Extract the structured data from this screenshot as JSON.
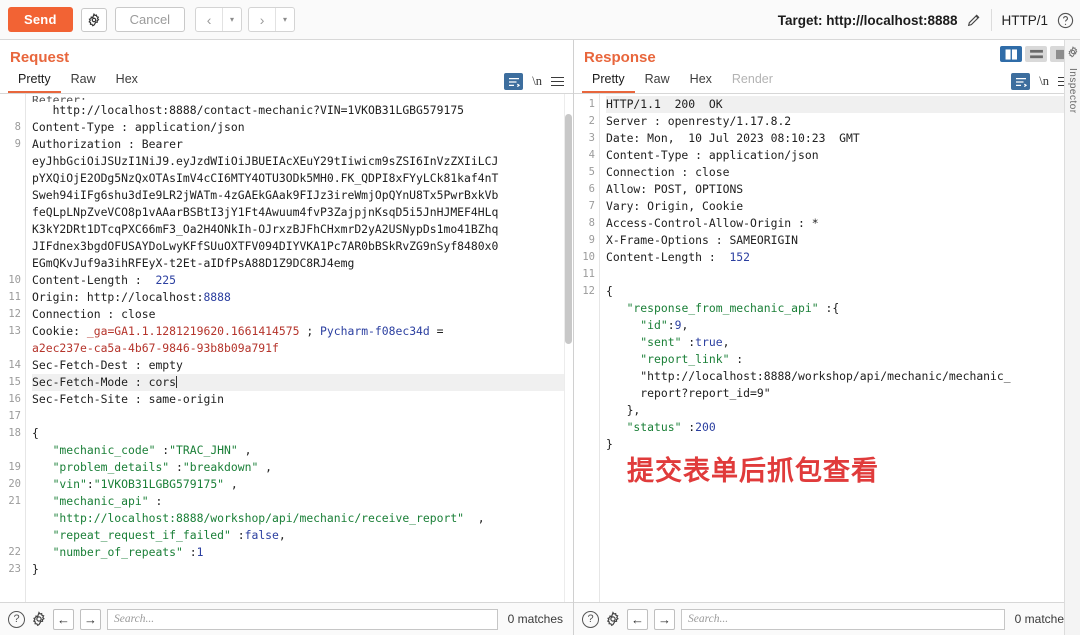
{
  "toolbar": {
    "send_label": "Send",
    "settings_icon": "gear-icon",
    "cancel_label": "Cancel",
    "prev_arrow": "‹",
    "next_arrow": "›",
    "caret": "▾",
    "target_label": "Target: http://localhost:8888",
    "edit_icon": "pencil-icon",
    "http_version": "HTTP/1",
    "help_icon": "question-circle-icon"
  },
  "request": {
    "title": "Request",
    "tabs": [
      {
        "label": "Pretty",
        "active": true,
        "disabled": false
      },
      {
        "label": "Raw",
        "active": false,
        "disabled": false
      },
      {
        "label": "Hex",
        "active": false,
        "disabled": false
      }
    ],
    "format_icon": "format-lines-icon",
    "newline_label": "\\n",
    "menu_icon": "hamburger-icon",
    "lines": [
      {
        "num": "",
        "text": "Referer:",
        "cut": true
      },
      {
        "num": "",
        "text": "   http://localhost:8888/contact-mechanic?VIN=1VKOB31LGBG579175"
      },
      {
        "num": "8",
        "text": "Content-Type : application/json"
      },
      {
        "num": "9",
        "text": "Authorization : Bearer"
      },
      {
        "num": "",
        "text": "eyJhbGciOiJSUzI1NiJ9.eyJzdWIiOiJBUEIAcXEuY29tIiwicm9sZSI6InVzZXIiLCJ"
      },
      {
        "num": "",
        "text": "pYXQiOjE2ODg5NzQxOTAsImV4cCI6MTY4OTU3ODk5MH0.FK_QDPI8xFYyLCk81kaf4nT"
      },
      {
        "num": "",
        "text": "Sweh94iIFg6shu3dIe9LR2jWATm-4zGAEkGAak9FIJz3ireWmjOpQYnU8Tx5PwrBxkVb"
      },
      {
        "num": "",
        "text": "feQLpLNpZveVCO8p1vAAarBSBtI3jY1Ft4Awuum4fvP3ZajpjnKsqD5i5JnHJMEF4HLq"
      },
      {
        "num": "",
        "text": "K3kY2DRt1DTcqPXC66mF3_Oa2H4ONkIh-OJrxzBJFhCHxmrD2yA2USNypDs1mo41BZhq"
      },
      {
        "num": "",
        "text": "JIFdnex3bgdOFUSAYDoLwyKFfSUuOXTFV094DIYVKA1Pc7AR0bBSkRvZG9nSyf8480x0"
      },
      {
        "num": "",
        "text": "EGmQKvJuf9a3ihRFEyX-t2Et-aIDfPsA88D1Z9DC8RJ4emg"
      },
      {
        "num": "10",
        "text": "Content-Length :  225"
      },
      {
        "num": "11",
        "text": "Origin: http://localhost:8888"
      },
      {
        "num": "12",
        "text": "Connection : close"
      },
      {
        "num": "13",
        "text": "Cookie: _ga=GA1.1.1281219620.1661414575 ; Pycharm-f08ec34d ="
      },
      {
        "num": "",
        "text": "a2ec237e-ca5a-4b67-9846-93b8b09a791f"
      },
      {
        "num": "14",
        "text": "Sec-Fetch-Dest : empty"
      },
      {
        "num": "15",
        "text": "Sec-Fetch-Mode : cors"
      },
      {
        "num": "16",
        "text": "Sec-Fetch-Site : same-origin"
      },
      {
        "num": "17",
        "text": ""
      },
      {
        "num": "18",
        "text": "{"
      },
      {
        "num": "",
        "text": "   \"mechanic_code\" :\"TRAC_JHN\" ,"
      },
      {
        "num": "19",
        "text": "   \"problem_details\" :\"breakdown\" ,"
      },
      {
        "num": "20",
        "text": "   \"vin\":\"1VKOB31LGBG579175\" ,"
      },
      {
        "num": "21",
        "text": "   \"mechanic_api\" :"
      },
      {
        "num": "",
        "text": "   \"http://localhost:8888/workshop/api/mechanic/receive_report\"  ,"
      },
      {
        "num": "",
        "text": "   \"repeat_request_if_failed\" :false,"
      },
      {
        "num": "22",
        "text": "   \"number_of_repeats\" :1"
      },
      {
        "num": "23",
        "text": "}"
      }
    ]
  },
  "response": {
    "title": "Response",
    "tabs": [
      {
        "label": "Pretty",
        "active": true,
        "disabled": false
      },
      {
        "label": "Raw",
        "active": false,
        "disabled": false
      },
      {
        "label": "Hex",
        "active": false,
        "disabled": false
      },
      {
        "label": "Render",
        "active": false,
        "disabled": true
      }
    ],
    "format_icon": "format-lines-icon",
    "newline_label": "\\n",
    "menu_icon": "hamburger-icon",
    "layout_buttons": [
      "split-vertical-icon",
      "split-horizontal-icon",
      "single-pane-icon"
    ],
    "lines": [
      {
        "num": "1",
        "text": "HTTP/1.1  200  OK",
        "hl": true
      },
      {
        "num": "2",
        "text": "Server : openresty/1.17.8.2"
      },
      {
        "num": "3",
        "text": "Date: Mon,  10 Jul 2023 08:10:23  GMT"
      },
      {
        "num": "4",
        "text": "Content-Type : application/json"
      },
      {
        "num": "5",
        "text": "Connection : close"
      },
      {
        "num": "6",
        "text": "Allow: POST, OPTIONS"
      },
      {
        "num": "7",
        "text": "Vary: Origin, Cookie"
      },
      {
        "num": "8",
        "text": "Access-Control-Allow-Origin : *"
      },
      {
        "num": "9",
        "text": "X-Frame-Options : SAMEORIGIN"
      },
      {
        "num": "10",
        "text": "Content-Length :  152"
      },
      {
        "num": "11",
        "text": ""
      },
      {
        "num": "12",
        "text": "{"
      },
      {
        "num": "",
        "text": "   \"response_from_mechanic_api\" :{"
      },
      {
        "num": "",
        "text": "     \"id\":9,"
      },
      {
        "num": "",
        "text": "     \"sent\" :true,"
      },
      {
        "num": "",
        "text": "     \"report_link\" :"
      },
      {
        "num": "",
        "text": "     \"http://localhost:8888/workshop/api/mechanic/mechanic_"
      },
      {
        "num": "",
        "text": "     report?report_id=9\""
      },
      {
        "num": "",
        "text": "   },"
      },
      {
        "num": "",
        "text": "   \"status\" :200"
      },
      {
        "num": "",
        "text": "}"
      }
    ],
    "annotation": "提交表单后抓包查看"
  },
  "bottom_bar": {
    "help_icon": "question-circle-icon",
    "settings_icon": "gear-icon",
    "back_arrow": "←",
    "forward_arrow": "→",
    "search_value": "",
    "search_placeholder": "Search...",
    "matches_label": "0 matches"
  },
  "edge_strip": {
    "gear_icon": "gear-icon",
    "vertical_label": "Inspector"
  },
  "colors": {
    "accent_orange": "#f26334",
    "title_orange": "#e8663c",
    "annotation_red": "#e03b3b",
    "string_green": "#1a7f37",
    "cookie_red": "#b5342b",
    "blue": "#2b3fa0",
    "format_blue": "#3d6e9e"
  }
}
